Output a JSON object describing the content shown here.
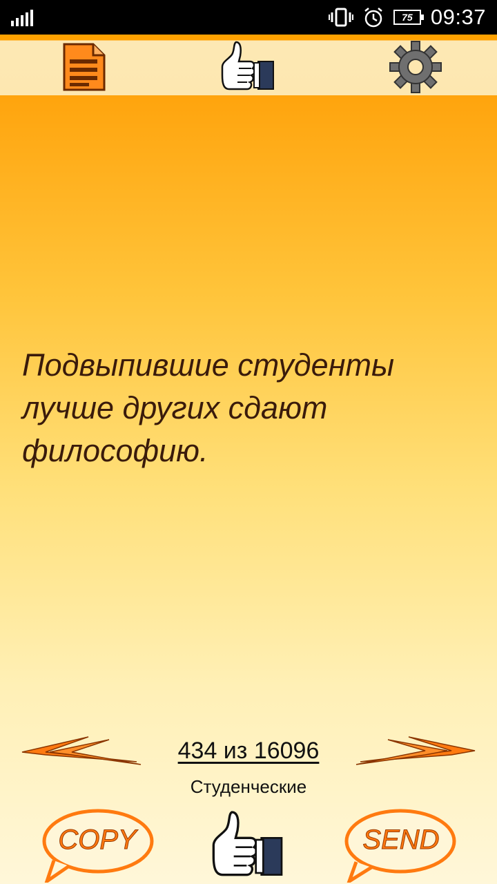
{
  "status_bar": {
    "time": "09:37",
    "battery": "75",
    "icons": [
      "signal-icon",
      "vibrate-icon",
      "alarm-icon",
      "battery-icon"
    ]
  },
  "toolbar": {
    "icons": [
      "document-list-icon",
      "thumbs-up-icon",
      "gear-icon"
    ]
  },
  "quote": {
    "text": "Подвыпившие студенты лучше других сдают философию."
  },
  "navigation": {
    "counter": "434 из 16096",
    "category": "Студенческие",
    "prev_icon": "double-arrow-left-icon",
    "next_icon": "double-arrow-right-icon"
  },
  "bottom_bar": {
    "copy_label": "COPY",
    "send_label": "SEND",
    "like_icon": "thumbs-up-icon"
  },
  "colors": {
    "accent_orange": "#ff7a10",
    "text_brown": "#3a1b0b",
    "gradient_top": "#ffa40d",
    "gradient_bottom": "#fff7d9"
  }
}
